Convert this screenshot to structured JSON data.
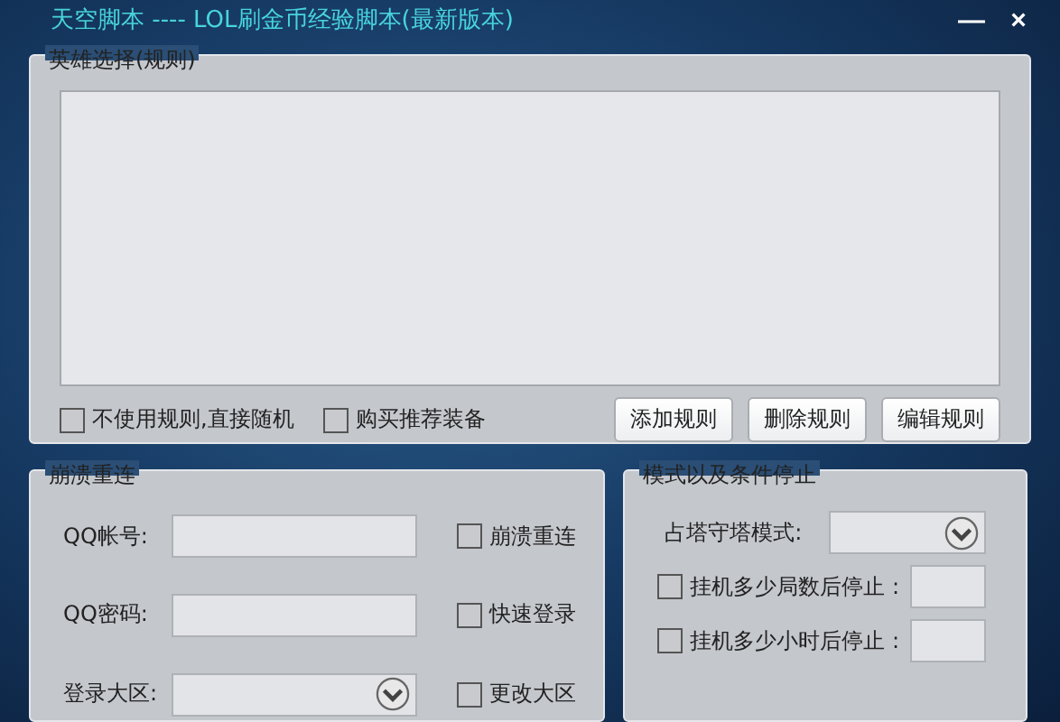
{
  "window": {
    "title": "天空脚本 ---- LOL刷金币经验脚本(最新版本)",
    "controls": [
      "—",
      "×"
    ]
  },
  "hero_group": {
    "title": "英雄选择(规则)",
    "options": [
      {
        "label": "不使用规则,直接随机",
        "checked": false
      },
      {
        "label": "购买推荐装备",
        "checked": false
      }
    ],
    "buttons": [
      "添加规则",
      "删除规则",
      "编辑规则"
    ]
  },
  "reconnect_group": {
    "title": "崩溃重连",
    "fields": [
      {
        "label": "QQ帐号:",
        "kind": "text"
      },
      {
        "label": "QQ密码:",
        "kind": "text"
      },
      {
        "label": "登录大区:",
        "kind": "select"
      }
    ],
    "options": [
      {
        "label": "崩溃重连",
        "checked": false
      },
      {
        "label": "快速登录",
        "checked": false
      },
      {
        "label": "更改大区",
        "checked": false
      }
    ]
  },
  "stop_group": {
    "title": "模式以及条件停止",
    "mode": {
      "label": "占塔守塔模式:"
    },
    "options": [
      {
        "label": "挂机多少局数后停止 :",
        "checked": false
      },
      {
        "label": "挂机多少小时后停止 :",
        "checked": false
      }
    ]
  }
}
